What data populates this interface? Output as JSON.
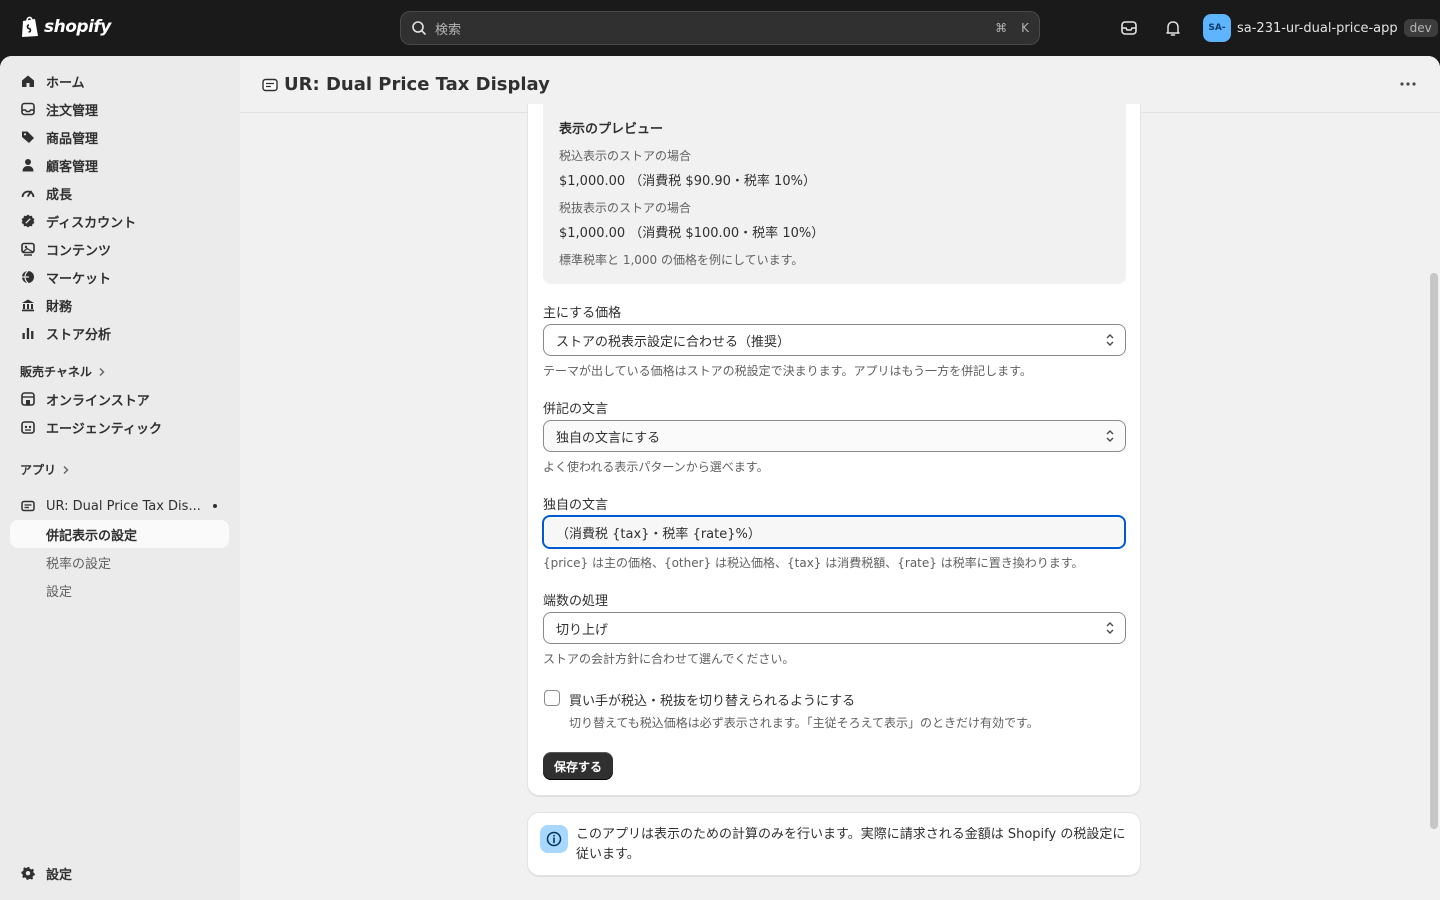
{
  "topbar": {
    "brand": "shopify",
    "search_placeholder": "検索",
    "shortcut_cmd": "⌘",
    "shortcut_key": "K",
    "store_avatar": "SA-",
    "store_name": "sa-231-ur-dual-price-app",
    "store_badge": "dev"
  },
  "sidebar": {
    "items": [
      {
        "label": "ホーム",
        "icon": "home-icon"
      },
      {
        "label": "注文管理",
        "icon": "orders-icon"
      },
      {
        "label": "商品管理",
        "icon": "tag-icon"
      },
      {
        "label": "顧客管理",
        "icon": "person-icon"
      },
      {
        "label": "成長",
        "icon": "gauge-icon"
      },
      {
        "label": "ディスカウント",
        "icon": "discount-icon"
      },
      {
        "label": "コンテンツ",
        "icon": "content-icon"
      },
      {
        "label": "マーケット",
        "icon": "globe-icon"
      },
      {
        "label": "財務",
        "icon": "bank-icon"
      },
      {
        "label": "ストア分析",
        "icon": "chart-icon"
      }
    ],
    "sales_channels_label": "販売チャネル",
    "channels": [
      {
        "label": "オンラインストア",
        "icon": "store-icon"
      },
      {
        "label": "エージェンティック",
        "icon": "agent-icon"
      }
    ],
    "apps_label": "アプリ",
    "app_name": "UR: Dual Price Tax Dis...",
    "app_subitems": [
      {
        "label": "併記表示の設定"
      },
      {
        "label": "税率の設定"
      },
      {
        "label": "設定"
      }
    ],
    "settings_label": "設定"
  },
  "header": {
    "title": "UR: Dual Price Tax Display"
  },
  "preview": {
    "heading": "表示のプレビュー",
    "incl_caption": "税込表示のストアの場合",
    "incl_value": "$1,000.00 （消費税 $90.90・税率 10%）",
    "excl_caption": "税抜表示のストアの場合",
    "excl_value": "$1,000.00 （消費税 $100.00・税率 10%）",
    "note": "標準税率と 1,000 の価格を例にしています。"
  },
  "form": {
    "primary_price_label": "主にする価格",
    "primary_price_value": "ストアの税表示設定に合わせる（推奨）",
    "primary_price_help": "テーマが出している価格はストアの税設定で決まります。アプリはもう一方を併記します。",
    "text_style_label": "併記の文言",
    "text_style_value": "独自の文言にする",
    "text_style_help": "よく使われる表示パターンから選べます。",
    "custom_text_label": "独自の文言",
    "custom_text_value": "（消費税 {tax}・税率 {rate}%）",
    "custom_text_help": "{price} は主の価格、{other} は税込価格、{tax} は消費税額、{rate} は税率に置き換わります。",
    "rounding_label": "端数の処理",
    "rounding_value": "切り上げ",
    "rounding_help": "ストアの会計方針に合わせて選んでください。",
    "toggle_label": "買い手が税込・税抜を切り替えられるようにする",
    "toggle_help": "切り替えても税込価格は必ず表示されます。「主従そろえて表示」のときだけ有効です。",
    "save_label": "保存する"
  },
  "banner": {
    "text": "このアプリは表示のための計算のみを行います。実際に請求される金額は Shopify の税設定に従います。"
  }
}
